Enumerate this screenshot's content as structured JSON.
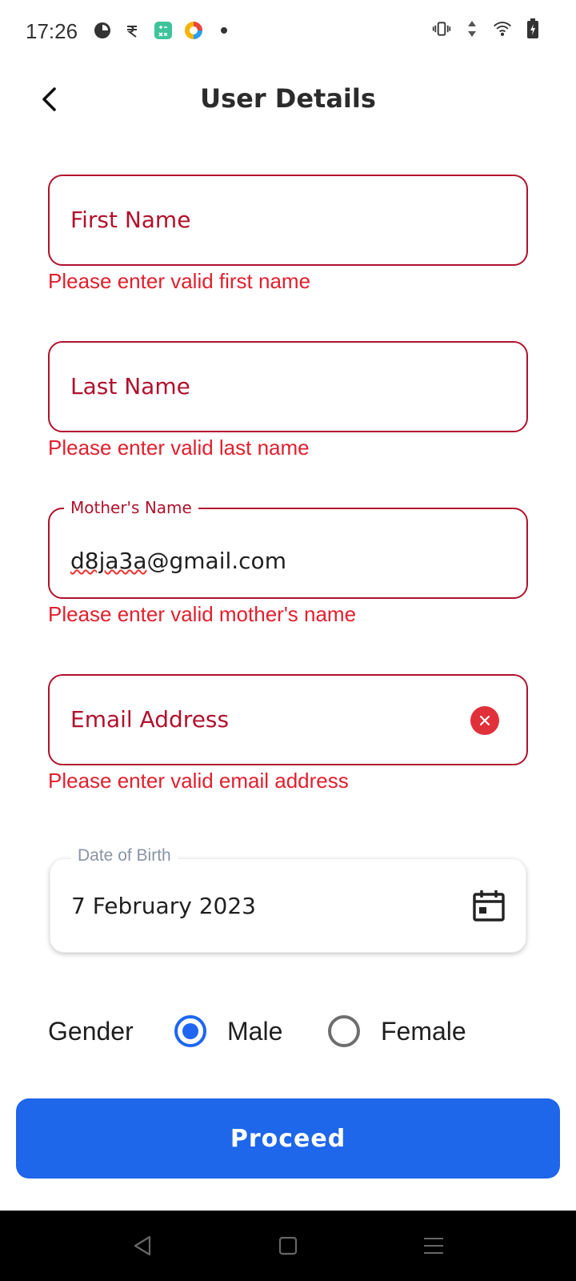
{
  "status_bar": {
    "time": "17:26",
    "left_icons": [
      "notification-app-icon",
      "rupee-icon",
      "calculator-app-icon",
      "color-app-icon",
      "more-dot-icon"
    ],
    "right_icons": [
      "vibrate-icon",
      "data-arrows-icon",
      "wifi-icon",
      "battery-charging-icon"
    ]
  },
  "header": {
    "title": "User Details"
  },
  "form": {
    "first_name": {
      "placeholder": "First Name",
      "error": "Please enter valid first name"
    },
    "last_name": {
      "placeholder": "Last Name",
      "error": "Please enter valid last name"
    },
    "mothers_name": {
      "label": "Mother's Name",
      "value_underlined": "d8ja3a",
      "value_rest": "@gmail.com",
      "error": "Please enter valid mother's name"
    },
    "email": {
      "placeholder": "Email Address",
      "error": "Please enter valid email address"
    },
    "dob": {
      "label": "Date of Birth",
      "value": "7 February 2023"
    },
    "gender": {
      "label": "Gender",
      "options": [
        "Male",
        "Female"
      ],
      "selected": "Male"
    }
  },
  "actions": {
    "proceed_label": "Proceed"
  },
  "colors": {
    "error": "#b0122c",
    "error_text": "#e0202e",
    "primary": "#1e66ea"
  }
}
